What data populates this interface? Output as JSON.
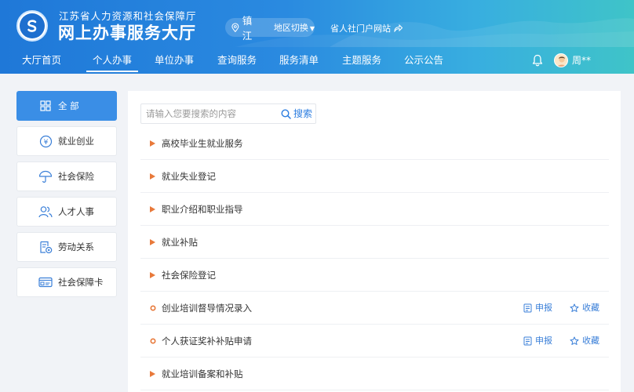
{
  "header": {
    "subtitle": "江苏省人力资源和社会保障厅",
    "title": "网上办事服务大厅",
    "city": "镇江",
    "region_switch": "地区切换",
    "portal_link": "省人社门户网站",
    "user_name": "周**",
    "brand_color": "#1f78d8"
  },
  "nav": {
    "items": [
      {
        "label": "大厅首页"
      },
      {
        "label": "个人办事"
      },
      {
        "label": "单位办事"
      },
      {
        "label": "查询服务"
      },
      {
        "label": "服务清单"
      },
      {
        "label": "主题服务"
      },
      {
        "label": "公示公告"
      }
    ],
    "active": "个人办事"
  },
  "sidebar": {
    "items": [
      {
        "label": "全 部",
        "icon": "grid-icon"
      },
      {
        "label": "就业创业",
        "icon": "coin-icon"
      },
      {
        "label": "社会保险",
        "icon": "umbrella-icon"
      },
      {
        "label": "人才人事",
        "icon": "people-icon"
      },
      {
        "label": "劳动关系",
        "icon": "document-settings-icon"
      },
      {
        "label": "社会保障卡",
        "icon": "card-icon"
      }
    ],
    "active_color": "#3a8ee6"
  },
  "search": {
    "placeholder": "请输入您要搜索的内容",
    "button": "搜索"
  },
  "services": [
    {
      "name": "高校毕业生就业服务",
      "type": "category"
    },
    {
      "name": "就业失业登记",
      "type": "category"
    },
    {
      "name": "职业介绍和职业指导",
      "type": "category"
    },
    {
      "name": "就业补贴",
      "type": "category"
    },
    {
      "name": "社会保险登记",
      "type": "category"
    },
    {
      "name": "创业培训督导情况录入",
      "type": "item",
      "apply": "申报",
      "favorite": "收藏"
    },
    {
      "name": "个人获证奖补补贴申请",
      "type": "item",
      "apply": "申报",
      "favorite": "收藏"
    },
    {
      "name": "就业培训备案和补贴",
      "type": "category"
    }
  ]
}
